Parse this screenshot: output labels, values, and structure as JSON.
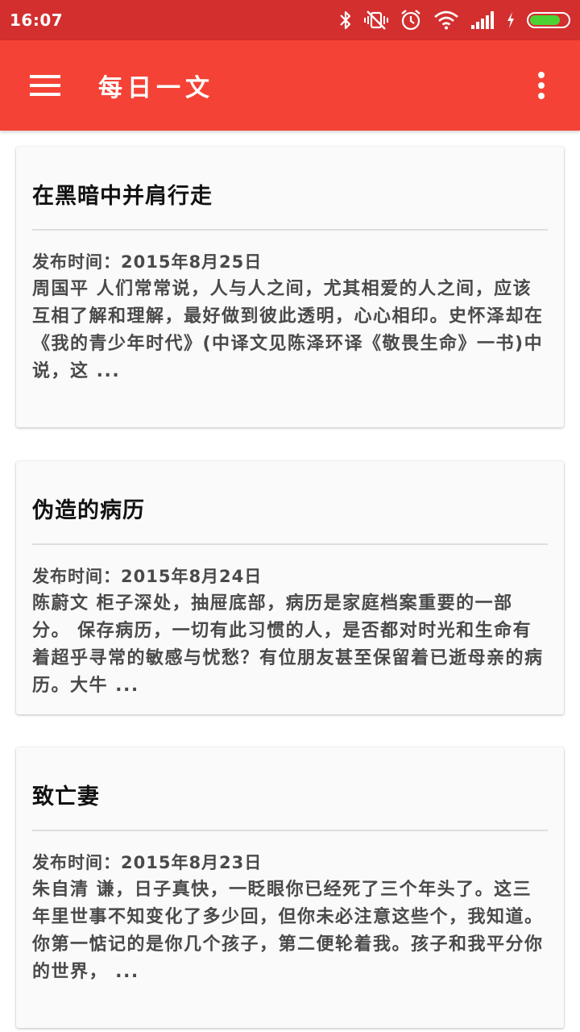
{
  "status_bar": {
    "time": "16:07",
    "icons": [
      "bluetooth-icon",
      "vibrate-off-icon",
      "alarm-icon",
      "wifi-icon",
      "signal-icon",
      "charging-icon",
      "battery-icon"
    ],
    "battery_level": 0.8,
    "battery_color": "#4cd134"
  },
  "app_bar": {
    "title": "每日一文",
    "color": "#f44336",
    "status_color": "#d32f2f"
  },
  "articles": [
    {
      "title": "在黑暗中并肩行走",
      "date": "发布时间：2015年8月25日",
      "excerpt": "周国平 人们常常说，人与人之间，尤其相爱的人之间，应该互相了解和理解，最好做到彼此透明，心心相印。史怀泽却在《我的青少年时代》(中译文见陈泽环译《敬畏生命》一书)中说，这 ..."
    },
    {
      "title": "伪造的病历",
      "date": "发布时间：2015年8月24日",
      "excerpt": "陈蔚文 柜子深处，抽屉底部，病历是家庭档案重要的一部分。 保存病历，一切有此习惯的人，是否都对时光和生命有着超乎寻常的敏感与忧愁？有位朋友甚至保留着已逝母亲的病历。大牛 ..."
    },
    {
      "title": "致亡妻",
      "date": "发布时间：2015年8月23日",
      "excerpt": "朱自清 谦，日子真快，一眨眼你已经死了三个年头了。这三年里世事不知变化了多少回，但你未必注意这些个，我知道。你第一惦记的是你几个孩子，第二便轮着我。孩子和我平分你的世界， ..."
    }
  ]
}
